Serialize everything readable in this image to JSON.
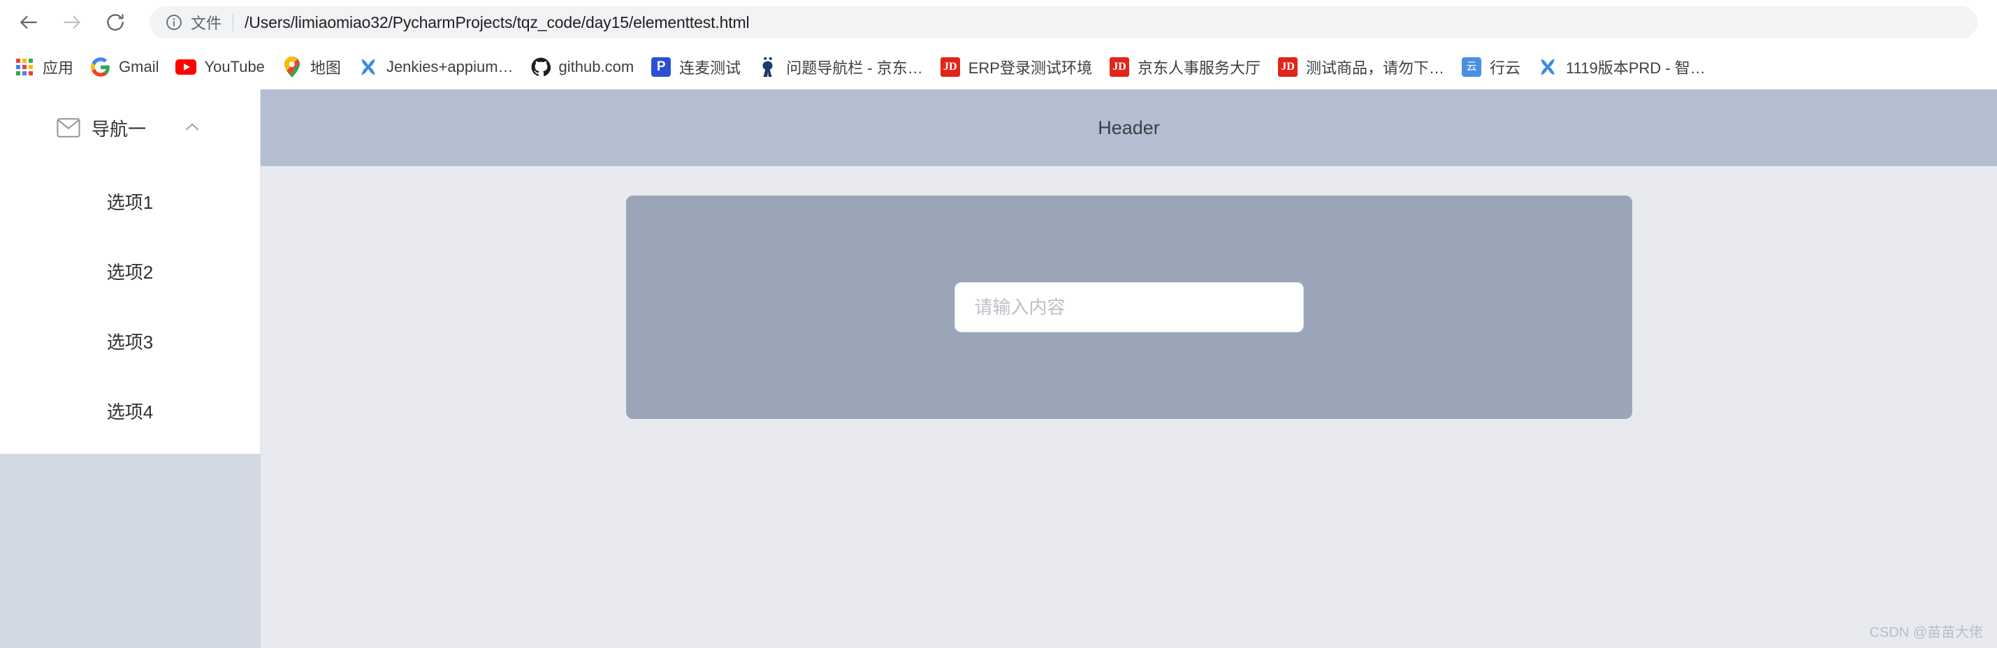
{
  "browser": {
    "back_icon": "back-arrow-icon",
    "forward_icon": "forward-arrow-icon",
    "reload_icon": "reload-icon",
    "omnibox": {
      "info_icon": "info-circle-icon",
      "scheme_label": "文件",
      "url": "/Users/limiaomiao32/PycharmProjects/tqz_code/day15/elementtest.html"
    },
    "bookmarks": [
      {
        "label": "应用",
        "icon": "apps-grid-icon"
      },
      {
        "label": "Gmail",
        "icon": "gmail-icon"
      },
      {
        "label": "YouTube",
        "icon": "youtube-icon"
      },
      {
        "label": "地图",
        "icon": "google-maps-icon"
      },
      {
        "label": "Jenkies+appium…",
        "icon": "jenkins-x-icon"
      },
      {
        "label": "github.com",
        "icon": "github-icon"
      },
      {
        "label": "连麦测试",
        "icon": "pictorial-p-icon"
      },
      {
        "label": "问题导航栏 - 京东…",
        "icon": "jenkins-person-icon"
      },
      {
        "label": "ERP登录测试环境",
        "icon": "jd-icon"
      },
      {
        "label": "京东人事服务大厅",
        "icon": "jd-icon"
      },
      {
        "label": "测试商品，请勿下…",
        "icon": "jd-icon"
      },
      {
        "label": "行云",
        "icon": "xingyun-icon"
      },
      {
        "label": "1119版本PRD - 智…",
        "icon": "jenkins-x-icon"
      }
    ]
  },
  "page": {
    "sidebar": {
      "group": {
        "icon": "envelope-icon",
        "title": "导航一",
        "collapse_icon": "chevron-up-icon",
        "expanded": true
      },
      "items": [
        {
          "label": "选项1"
        },
        {
          "label": "选项2"
        },
        {
          "label": "选项3"
        },
        {
          "label": "选项4"
        }
      ]
    },
    "header": {
      "title": "Header"
    },
    "main": {
      "input": {
        "value": "",
        "placeholder": "请输入内容"
      }
    },
    "watermark": "CSDN @苗苗大佬"
  },
  "colors": {
    "header_bar": "#b3bfd1",
    "content_card": "#9aa6b8",
    "content_bg": "#e8eaef",
    "sidebar_bottom": "#d3d9e3",
    "sidebar_panel": "#ffffff"
  }
}
